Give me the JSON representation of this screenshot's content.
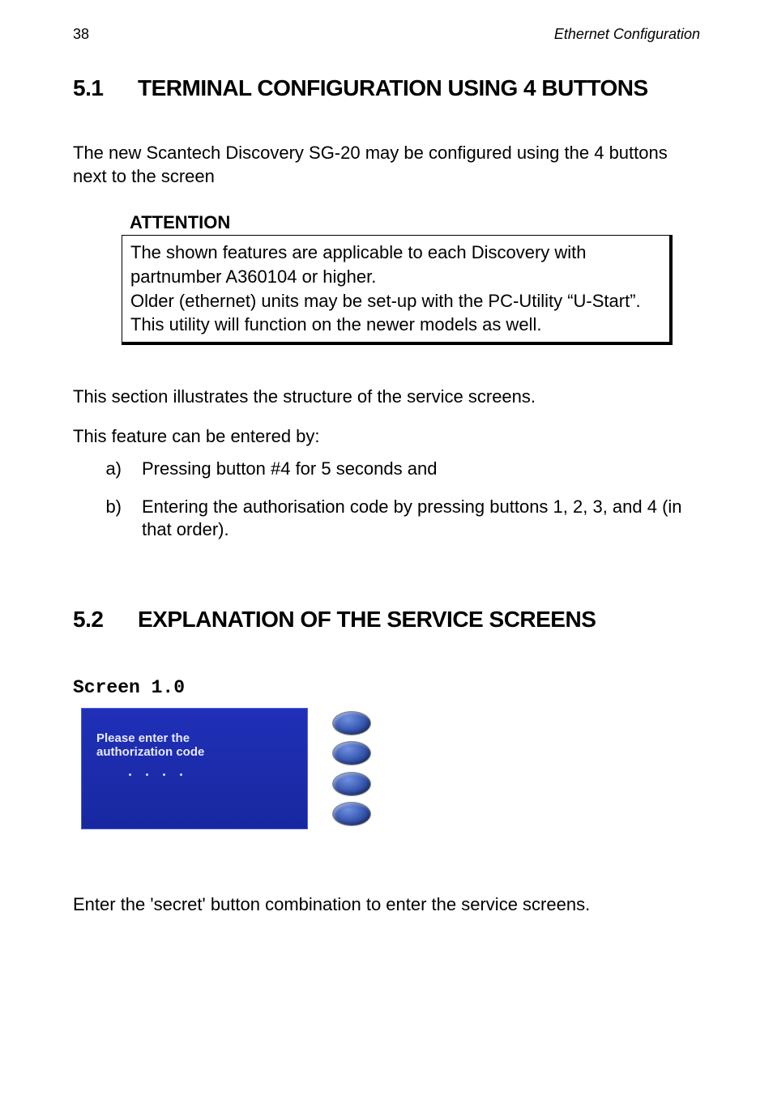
{
  "header": {
    "page_number": "38",
    "title": "Ethernet Configuration"
  },
  "section_5_1": {
    "number": "5.1",
    "title": "TERMINAL CONFIGURATION USING 4 BUTTONS",
    "intro": "The new Scantech Discovery SG-20 may be configured using  the 4 buttons next to the screen"
  },
  "attention": {
    "label": "ATTENTION",
    "line1": "The shown features are applicable to each Discovery with partnumber A360104 or higher.",
    "line2": "Older (ethernet) units may be set-up with the PC-Utility “U-Start”.",
    "line3": "This utility will function on the newer models as well."
  },
  "mid_text": {
    "p1": "This section illustrates the structure of the service screens.",
    "p2": "This feature can be entered by:"
  },
  "list": {
    "a_marker": "a)",
    "a_text": "Pressing button #4 for 5 seconds and",
    "b_marker": "b)",
    "b_text": "Entering the authorisation code by pressing buttons 1, 2, 3, and 4 (in that order)."
  },
  "section_5_2": {
    "number": "5.2",
    "title": "EXPLANATION OF THE SERVICE SCREENS"
  },
  "screen": {
    "label": "Screen  1.0",
    "line1": "Please enter the",
    "line2": "authorization code"
  },
  "final": {
    "text": "Enter the 'secret' button combination to enter the service screens."
  }
}
